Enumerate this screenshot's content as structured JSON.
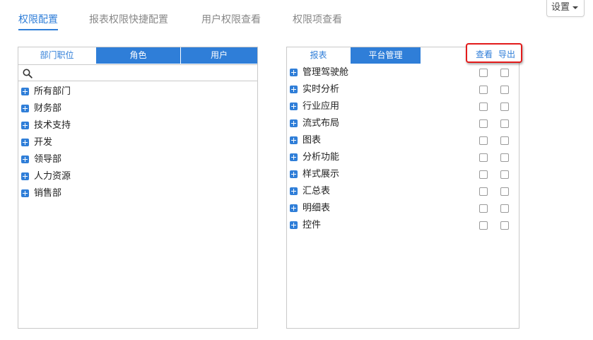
{
  "top_tabs": [
    {
      "label": "权限配置",
      "active": true
    },
    {
      "label": "报表权限快捷配置",
      "active": false
    },
    {
      "label": "用户权限查看",
      "active": false
    },
    {
      "label": "权限项查看",
      "active": false
    }
  ],
  "settings": {
    "label": "设置"
  },
  "left_panel": {
    "tabs": [
      {
        "label": "部门职位",
        "active": true
      },
      {
        "label": "角色",
        "active": false
      },
      {
        "label": "用户",
        "active": false
      }
    ],
    "search": {
      "placeholder": "",
      "value": ""
    },
    "tree": [
      {
        "label": "所有部门"
      },
      {
        "label": "财务部"
      },
      {
        "label": "技术支持"
      },
      {
        "label": "开发"
      },
      {
        "label": "领导部"
      },
      {
        "label": "人力资源"
      },
      {
        "label": "销售部"
      }
    ]
  },
  "right_panel": {
    "tabs": [
      {
        "label": "报表",
        "active": true
      },
      {
        "label": "平台管理",
        "active": false
      }
    ],
    "columns": {
      "view": "查看",
      "export": "导出"
    },
    "tree": [
      {
        "label": "管理驾驶舱",
        "view": false,
        "export": false
      },
      {
        "label": "实时分析",
        "view": false,
        "export": false
      },
      {
        "label": "行业应用",
        "view": false,
        "export": false
      },
      {
        "label": "流式布局",
        "view": false,
        "export": false
      },
      {
        "label": "图表",
        "view": false,
        "export": false
      },
      {
        "label": "分析功能",
        "view": false,
        "export": false
      },
      {
        "label": "样式展示",
        "view": false,
        "export": false
      },
      {
        "label": "汇总表",
        "view": false,
        "export": false
      },
      {
        "label": "明细表",
        "view": false,
        "export": false
      },
      {
        "label": "控件",
        "view": false,
        "export": false
      }
    ]
  },
  "colors": {
    "accent": "#2f7ed8",
    "highlight": "#e31b1b"
  }
}
